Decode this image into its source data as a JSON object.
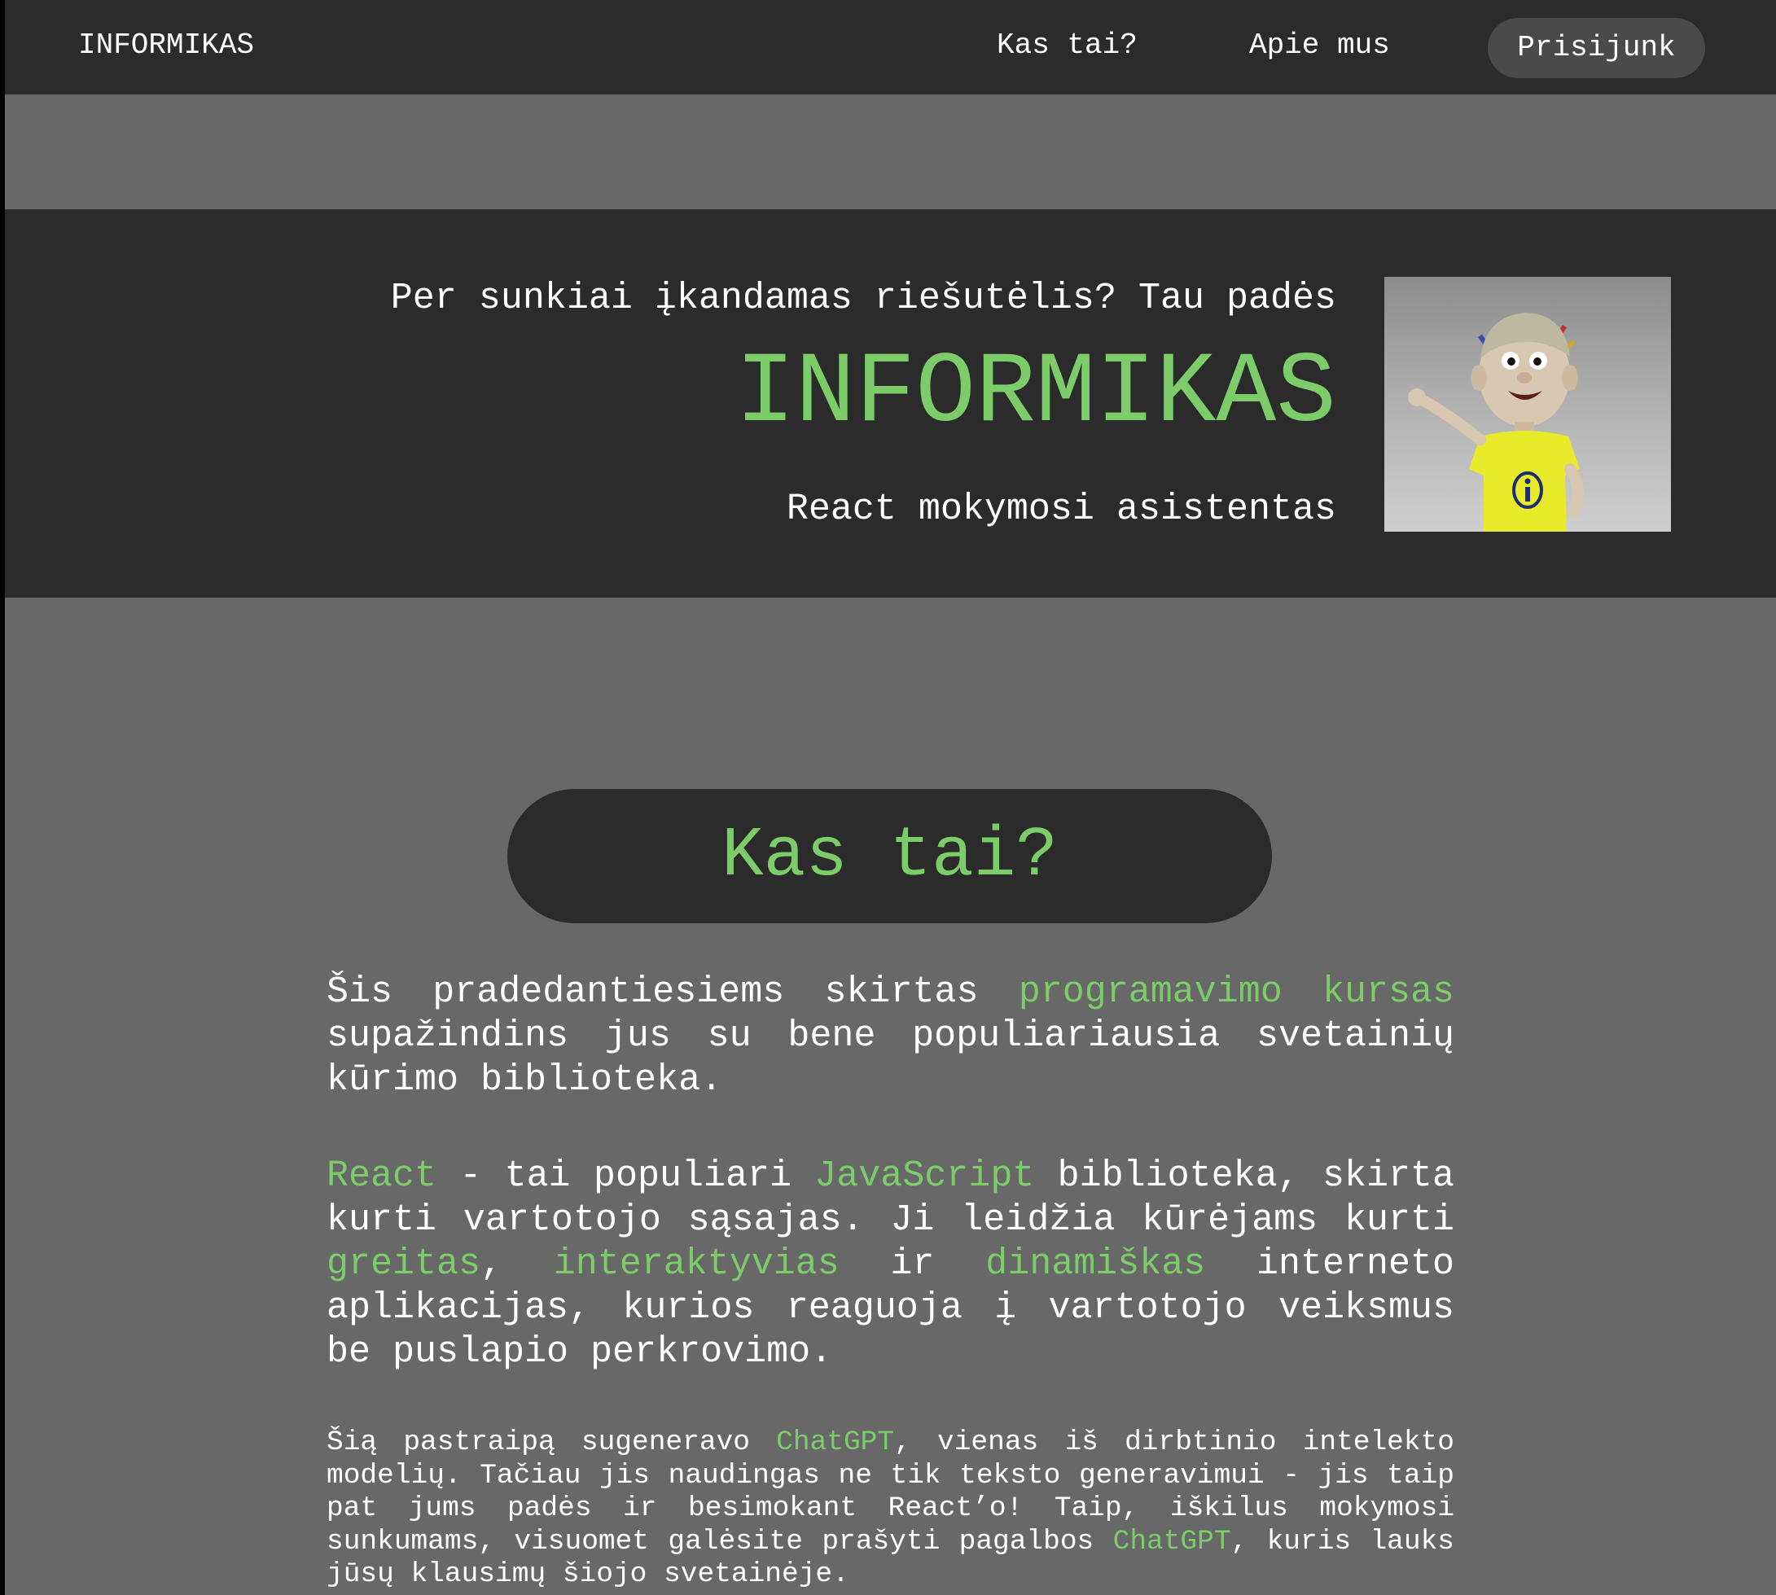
{
  "navbar": {
    "brand": "INFORMIKAS",
    "links": [
      "Kas tai?",
      "Apie mus"
    ],
    "login_label": "Prisijunk"
  },
  "hero": {
    "tagline": "Per sunkiai įkandamas riešutėlis? Tau padės",
    "title": "INFORMIKAS",
    "subtitle": "React mokymosi asistentas"
  },
  "section": {
    "heading": "Kas tai?",
    "p1": {
      "a": "Šis pradedantiesiems skirtas ",
      "hl": "programavimo kursas",
      "b": " supažindins jus su bene populiariausia svetainių kūrimo biblioteka."
    },
    "p2": {
      "hl1": "React",
      "a": " - tai populiari ",
      "hl2": "JavaScript",
      "b": " biblioteka, skirta kurti vartotojo sąsajas. Ji leidžia kūrėjams kurti ",
      "hl3": "greitas",
      "c": ", ",
      "hl4": "interaktyvias",
      "d": " ir ",
      "hl5": "dinamiškas",
      "e": " interneto aplikacijas, kurios reaguoja į vartotojo veiksmus be puslapio perkrovimo."
    },
    "p3": {
      "a": "Šią pastraipą sugeneravo ",
      "hl1": "ChatGPT",
      "b": ", vienas iš dirbtinio intelekto modelių. Tačiau jis naudingas ne tik teksto generavimui - jis taip pat jums padės ir besimokant React’o! Taip, iškilus mokymosi sunkumams, visuomet galėsite prašyti pagalbos ",
      "hl2": "ChatGPT",
      "c": ", kuris lauks jūsų klausimų šiojo svetainėje."
    }
  },
  "colors": {
    "accent": "#7ccc6a",
    "dark": "#2b2b2b",
    "page_bg": "#686868",
    "button_bg": "#4a4a4a"
  },
  "icons": {
    "hero_image": "informikas-mascot"
  }
}
